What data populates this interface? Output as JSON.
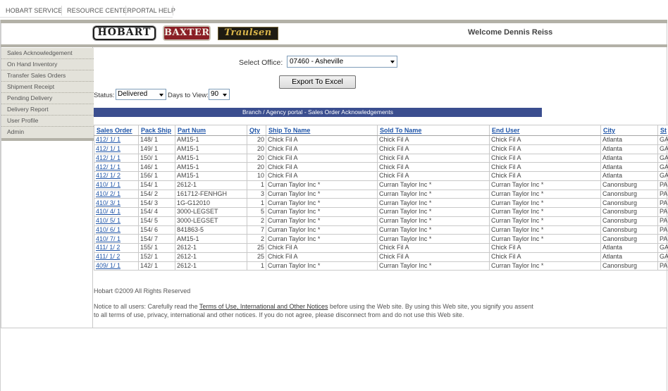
{
  "topnav": {
    "items": [
      "HOBART SERVICE",
      "RESOURCE CENTER",
      "PORTAL HELP"
    ]
  },
  "header": {
    "logos": [
      "HOBART",
      "BAXTER",
      "Traulsen"
    ],
    "welcome": "Welcome Dennis Reiss"
  },
  "sidebar": {
    "items": [
      "Sales Acknowledgement",
      "On Hand Inventory",
      "Transfer Sales Orders",
      "Shipment Receipt",
      "Pending Delivery",
      "Delivery Report",
      "User Profile",
      "Admin"
    ]
  },
  "filters": {
    "office_label": "Select Office:",
    "office_value": "07460 - Asheville",
    "export_label": "Export To Excel",
    "status_label": "Status:",
    "status_value": "Delivered",
    "days_label": "Days to View:",
    "days_value": "90"
  },
  "table": {
    "title": "Branch / Agency portal - Sales Order Acknowledgements",
    "columns": [
      "Sales Order",
      "Pack Ship",
      "Part Num",
      "Qty",
      "Ship To Name",
      "Sold To Name",
      "End User",
      "City",
      "St"
    ],
    "rows": [
      [
        "412/ 1/ 1",
        "148/ 1",
        "AM15-1",
        "20",
        "Chick Fil A",
        "Chick Fil A",
        "Chick Fil A",
        "Atlanta",
        "GA"
      ],
      [
        "412/ 1/ 1",
        "149/ 1",
        "AM15-1",
        "20",
        "Chick Fil A",
        "Chick Fil A",
        "Chick Fil A",
        "Atlanta",
        "GA"
      ],
      [
        "412/ 1/ 1",
        "150/ 1",
        "AM15-1",
        "20",
        "Chick Fil A",
        "Chick Fil A",
        "Chick Fil A",
        "Atlanta",
        "GA"
      ],
      [
        "412/ 1/ 1",
        "146/ 1",
        "AM15-1",
        "20",
        "Chick Fil A",
        "Chick Fil A",
        "Chick Fil A",
        "Atlanta",
        "GA"
      ],
      [
        "412/ 1/ 2",
        "156/ 1",
        "AM15-1",
        "10",
        "Chick Fil A",
        "Chick Fil A",
        "Chick Fil A",
        "Atlanta",
        "GA"
      ],
      [
        "410/ 1/ 1",
        "154/ 1",
        "2612-1",
        "1",
        "Curran Taylor Inc *",
        "Curran Taylor Inc *",
        "Curran Taylor Inc *",
        "Canonsburg",
        "PA"
      ],
      [
        "410/ 2/ 1",
        "154/ 2",
        "161712-FENHGH",
        "3",
        "Curran Taylor Inc *",
        "Curran Taylor Inc *",
        "Curran Taylor Inc *",
        "Canonsburg",
        "PA"
      ],
      [
        "410/ 3/ 1",
        "154/ 3",
        "1G-G12010",
        "1",
        "Curran Taylor Inc *",
        "Curran Taylor Inc *",
        "Curran Taylor Inc *",
        "Canonsburg",
        "PA"
      ],
      [
        "410/ 4/ 1",
        "154/ 4",
        "3000-LEGSET",
        "5",
        "Curran Taylor Inc *",
        "Curran Taylor Inc *",
        "Curran Taylor Inc *",
        "Canonsburg",
        "PA"
      ],
      [
        "410/ 5/ 1",
        "154/ 5",
        "3000-LEGSET",
        "2",
        "Curran Taylor Inc *",
        "Curran Taylor Inc *",
        "Curran Taylor Inc *",
        "Canonsburg",
        "PA"
      ],
      [
        "410/ 6/ 1",
        "154/ 6",
        "841863-5",
        "7",
        "Curran Taylor Inc *",
        "Curran Taylor Inc *",
        "Curran Taylor Inc *",
        "Canonsburg",
        "PA"
      ],
      [
        "410/ 7/ 1",
        "154/ 7",
        "AM15-1",
        "2",
        "Curran Taylor Inc *",
        "Curran Taylor Inc *",
        "Curran Taylor Inc *",
        "Canonsburg",
        "PA"
      ],
      [
        "411/ 1/ 2",
        "155/ 1",
        "2612-1",
        "25",
        "Chick Fil A",
        "Chick Fil A",
        "Chick Fil A",
        "Atlanta",
        "GA"
      ],
      [
        "411/ 1/ 2",
        "152/ 1",
        "2612-1",
        "25",
        "Chick Fil A",
        "Chick Fil A",
        "Chick Fil A",
        "Atlanta",
        "GA"
      ],
      [
        "409/ 1/ 1",
        "142/ 1",
        "2612-1",
        "1",
        "Curran Taylor Inc *",
        "Curran Taylor Inc *",
        "Curran Taylor Inc *",
        "Canonsburg",
        "PA"
      ]
    ]
  },
  "footer": {
    "copyright": "Hobart ©2009 All Rights Reserved",
    "notice_prefix": "Notice to all users: Carefully read the ",
    "notice_link": "Terms of Use, International and Other Notices",
    "notice_suffix": " before using the Web site. By using this Web site, you signify you assent to all terms of use, privacy, international and other notices. If you do not agree, please disconnect from and do not use this Web site."
  }
}
